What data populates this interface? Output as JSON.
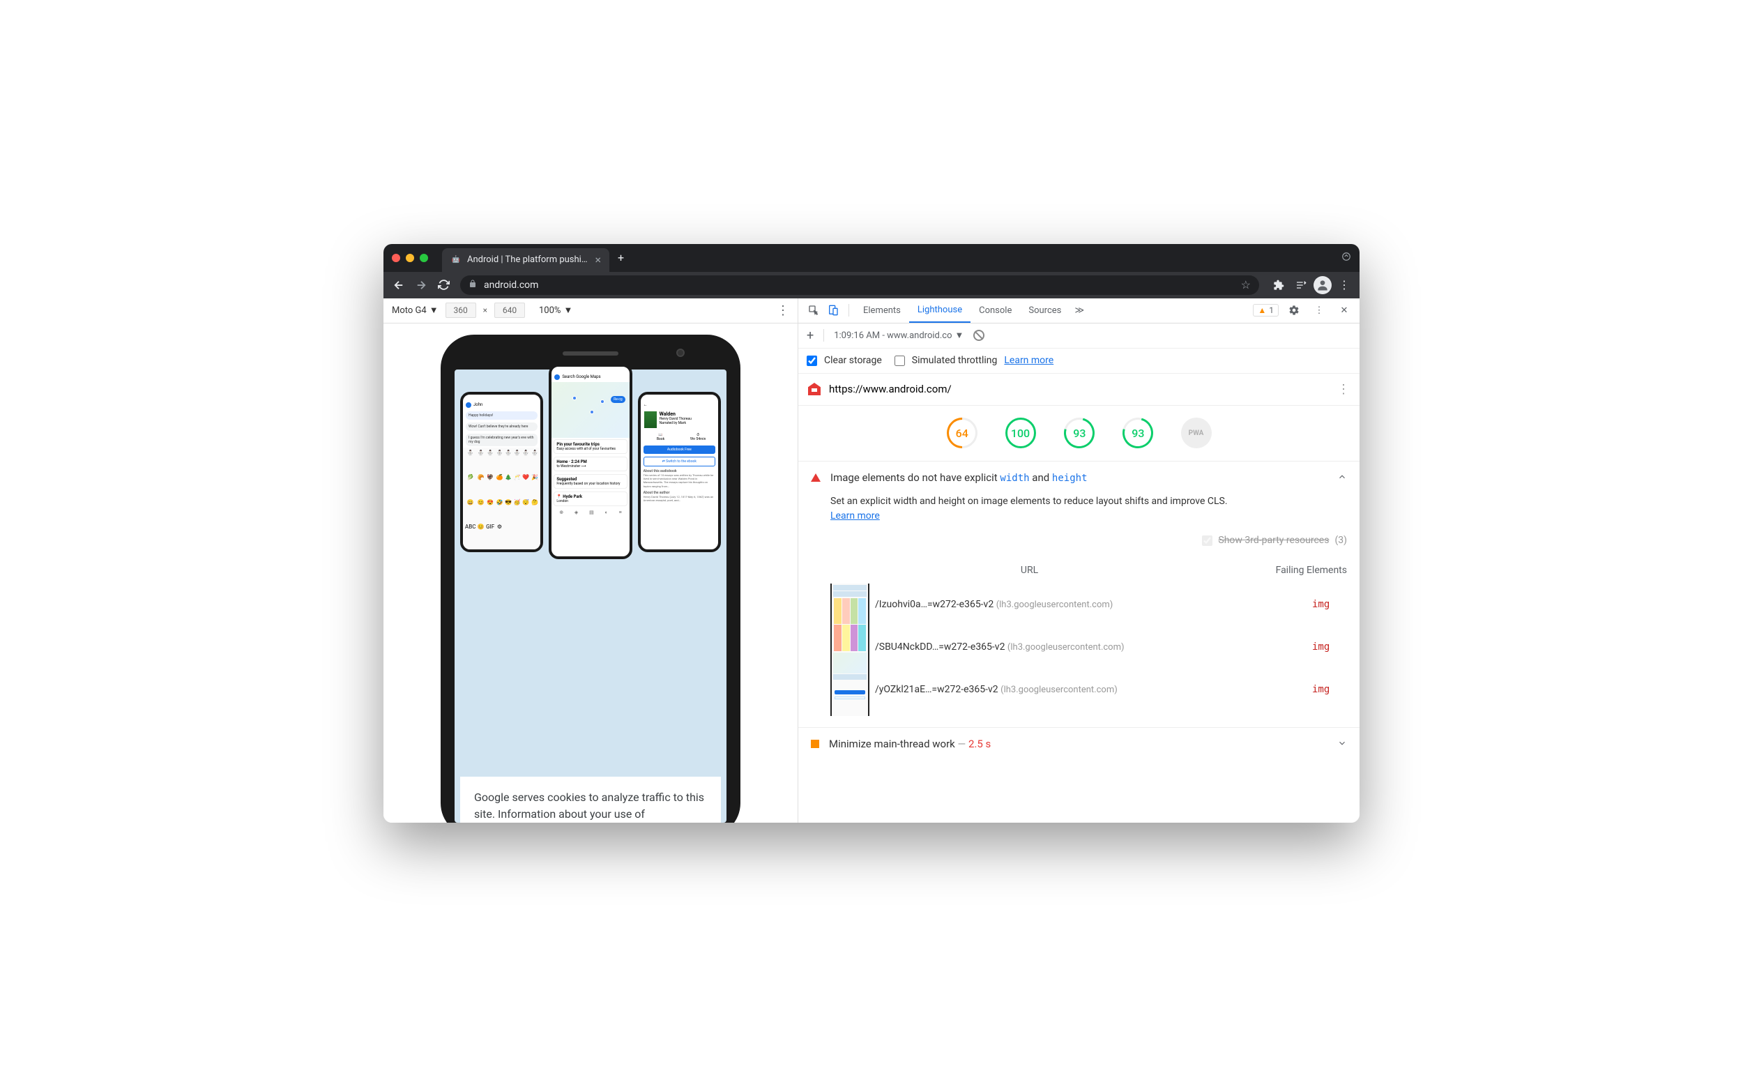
{
  "browser": {
    "tab_title": "Android | The platform pushing",
    "url": "android.com"
  },
  "device_toolbar": {
    "device": "Moto G4",
    "width": "360",
    "height": "640",
    "zoom": "100%"
  },
  "cookie_notice": "Google serves cookies to analyze traffic to this site. Information about your use of",
  "devtools": {
    "tabs": [
      "Elements",
      "Lighthouse",
      "Console",
      "Sources"
    ],
    "active_tab": "Lighthouse",
    "warning_count": "1",
    "lighthouse_bar": {
      "plus": "+",
      "timestamp": "1:09:16 AM - www.android.co"
    },
    "options": {
      "clear_storage": "Clear storage",
      "sim_throttle": "Simulated throttling",
      "learn_more": "Learn more"
    },
    "test_url": "https://www.android.com/",
    "scores": [
      {
        "value": "64",
        "class": "orange"
      },
      {
        "value": "100",
        "class": "green"
      },
      {
        "value": "93",
        "class": "green93"
      },
      {
        "value": "93",
        "class": "green93"
      },
      {
        "value": "PWA",
        "class": "grey"
      }
    ],
    "audit1": {
      "title_pre": "Image elements do not have explicit",
      "code1": "width",
      "and": " and ",
      "code2": "height",
      "desc": "Set an explicit width and height on image elements to reduce layout shifts and improve CLS.",
      "learn_more": "Learn more",
      "third_party": "Show 3rd-party resources",
      "third_party_count": "(3)",
      "col_url": "URL",
      "col_fail": "Failing Elements",
      "rows": [
        {
          "url": "/Izuohvi0a…=w272-e365-v2",
          "host": "(lh3.googleusercontent.com)",
          "tag": "img"
        },
        {
          "url": "/SBU4NckDD…=w272-e365-v2",
          "host": "(lh3.googleusercontent.com)",
          "tag": "img"
        },
        {
          "url": "/yOZkl21aE…=w272-e365-v2",
          "host": "(lh3.googleusercontent.com)",
          "tag": "img"
        }
      ]
    },
    "audit2": {
      "title": "Minimize main-thread work",
      "sep": " — ",
      "value": "2.5 s"
    }
  }
}
